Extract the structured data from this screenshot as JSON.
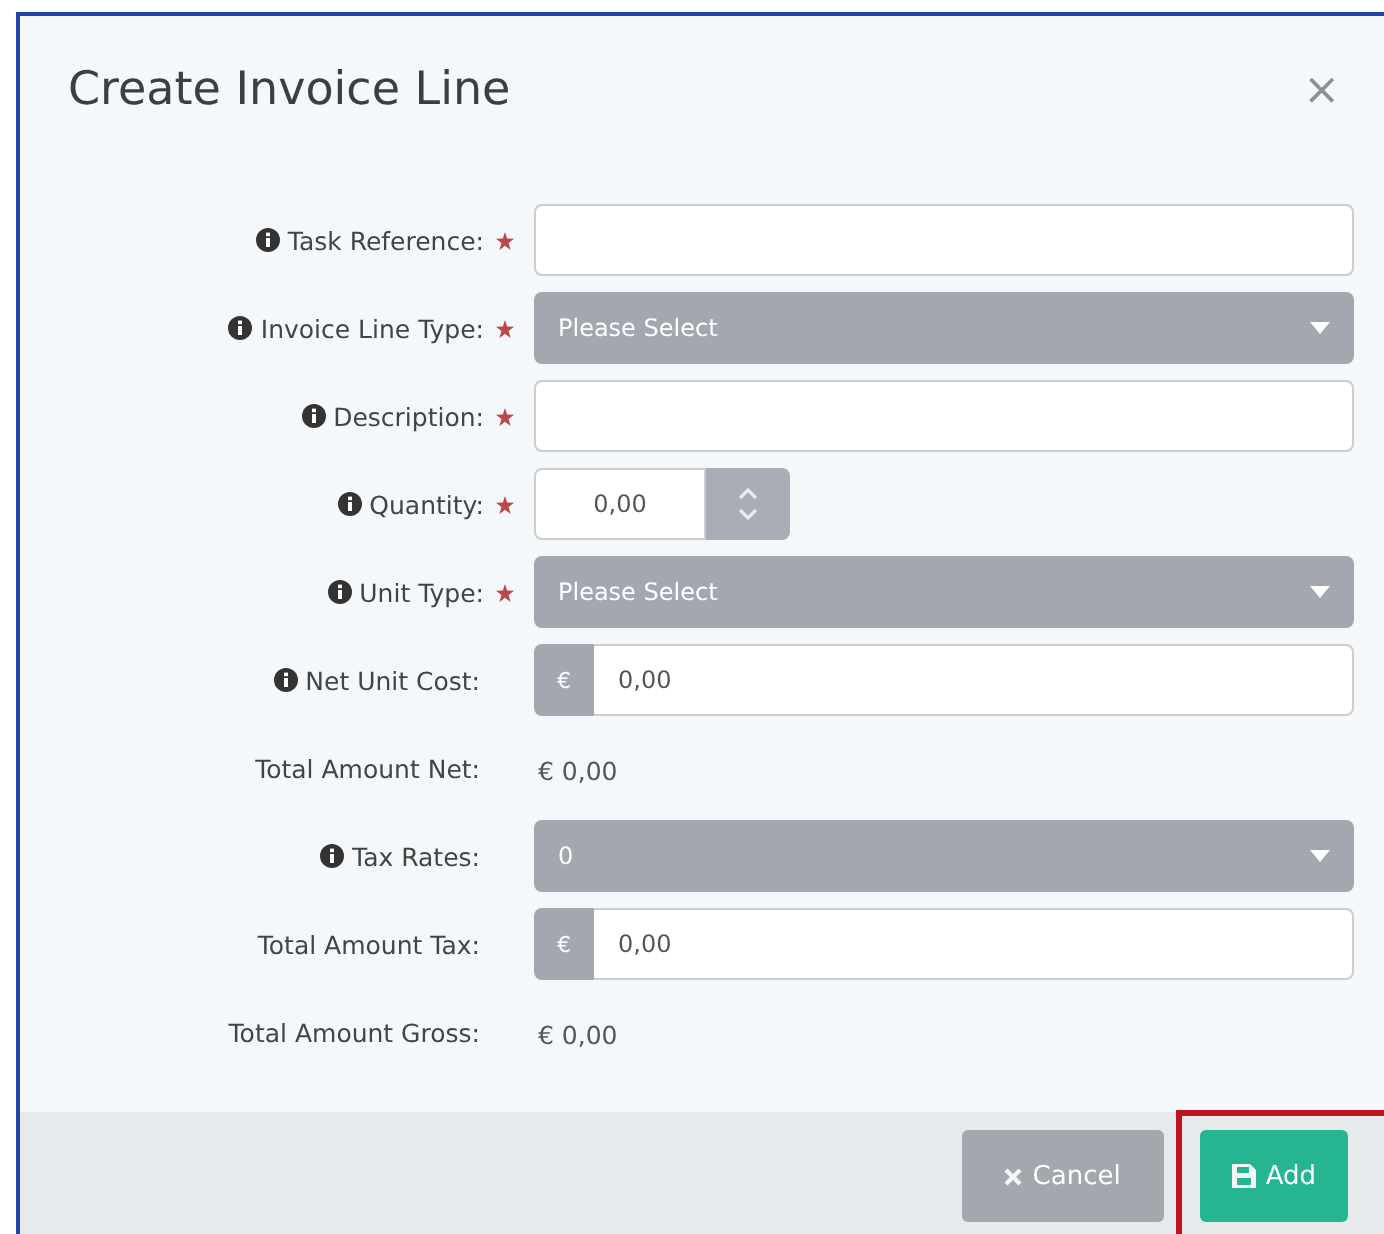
{
  "dialog": {
    "title": "Create Invoice Line",
    "close": "×"
  },
  "fields": [
    {
      "kind": "text",
      "label": "Task Reference:",
      "info": true,
      "required": true
    },
    {
      "kind": "select",
      "label": "Invoice Line Type:",
      "info": true,
      "required": true,
      "value": "Please Select"
    },
    {
      "kind": "text",
      "label": "Description:",
      "info": true,
      "required": true
    },
    {
      "kind": "number",
      "label": "Quantity:",
      "info": true,
      "required": true,
      "value": "0,00"
    },
    {
      "kind": "select",
      "label": "Unit Type:",
      "info": true,
      "required": true,
      "value": "Please Select"
    },
    {
      "kind": "currency",
      "label": "Net Unit Cost:",
      "info": true,
      "required": false,
      "prefix": "€",
      "value": "0,00"
    },
    {
      "kind": "static",
      "label": "Total Amount Net:",
      "info": false,
      "required": false,
      "value": "€ 0,00"
    },
    {
      "kind": "select",
      "label": "Tax Rates:",
      "info": true,
      "required": false,
      "value": "0"
    },
    {
      "kind": "currency",
      "label": "Total Amount Tax:",
      "info": false,
      "required": false,
      "prefix": "€",
      "value": "0,00"
    },
    {
      "kind": "static",
      "label": "Total Amount Gross:",
      "info": false,
      "required": false,
      "value": "€ 0,00"
    }
  ],
  "buttons": [
    {
      "kind": "cancel",
      "label": "Cancel",
      "highlighted": false
    },
    {
      "kind": "add",
      "label": "Add",
      "highlighted": true
    }
  ]
}
